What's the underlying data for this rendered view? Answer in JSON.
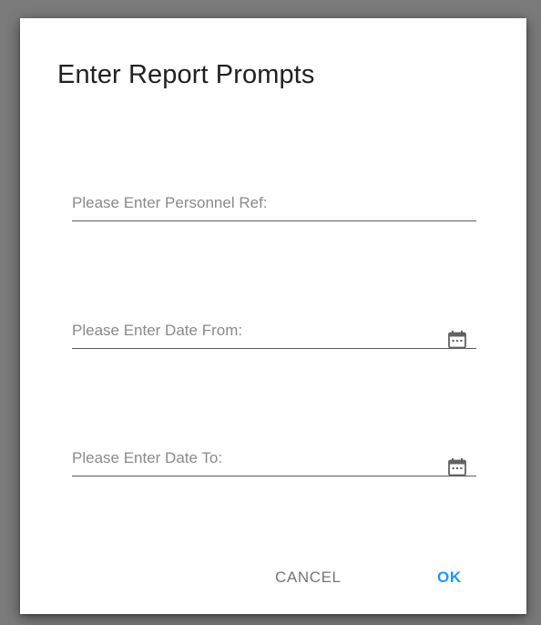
{
  "dialog": {
    "title": "Enter Report Prompts",
    "fields": [
      {
        "placeholder": "Please Enter Personnel Ref:",
        "value": ""
      },
      {
        "placeholder": "Please Enter Date From:",
        "value": "",
        "icon": "calendar-icon"
      },
      {
        "placeholder": "Please Enter Date To:",
        "value": "",
        "icon": "calendar-icon"
      }
    ],
    "buttons": {
      "cancel_label": "CANCEL",
      "ok_label": "OK"
    }
  },
  "colors": {
    "backdrop": "#7a7a7a",
    "dialog_background": "#ffffff",
    "accent": "#2196f3",
    "secondary_text": "#757575",
    "underline": "#5c5c5c"
  }
}
